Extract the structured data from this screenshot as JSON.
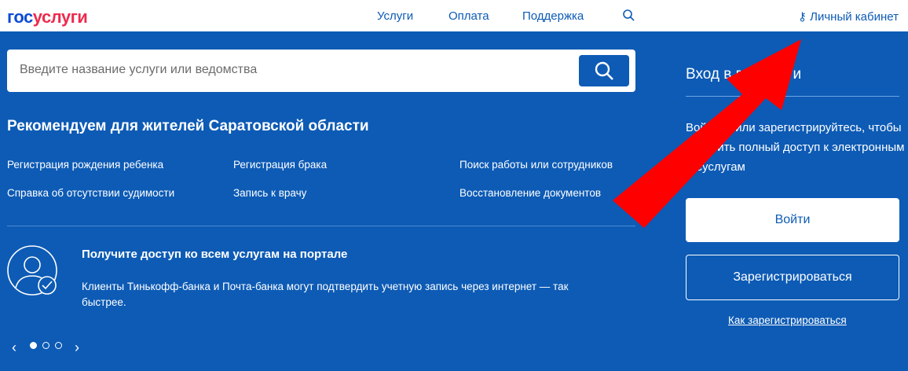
{
  "header": {
    "logo_a": "гос",
    "logo_b": "услуги",
    "nav": [
      "Услуги",
      "Оплата",
      "Поддержка"
    ],
    "cabinet": "Личный кабинет"
  },
  "search": {
    "placeholder": "Введите название услуги или ведомства"
  },
  "recommend": {
    "title": "Рекомендуем для жителей Саратовской области",
    "links": [
      "Регистрация рождения ребенка",
      "Регистрация брака",
      "Поиск работы или сотрудников",
      "Справка об отсутствии судимости",
      "Запись к врачу",
      "Восстановление документов"
    ]
  },
  "promo": {
    "title": "Получите доступ ко всем услугам на портале",
    "text": "Клиенты Тинькофф-банка и Почта-банка могут подтвердить учетную запись через интернет — так быстрее."
  },
  "login": {
    "title": "Вход в госуслуги",
    "text": "Войдите или зарегистрируйтесь, чтобы получить полный доступ к электронным госуслугам",
    "login_button": "Войти",
    "register_button": "Зарегистрироваться",
    "how_link": "Как зарегистрироваться"
  },
  "carousel": {
    "prev": "‹",
    "next": "›",
    "active": 1,
    "total": 3
  },
  "colors": {
    "brand_blue": "#0d5bb5",
    "logo_red": "#ee2b4e",
    "arrow": "#ff0000"
  }
}
